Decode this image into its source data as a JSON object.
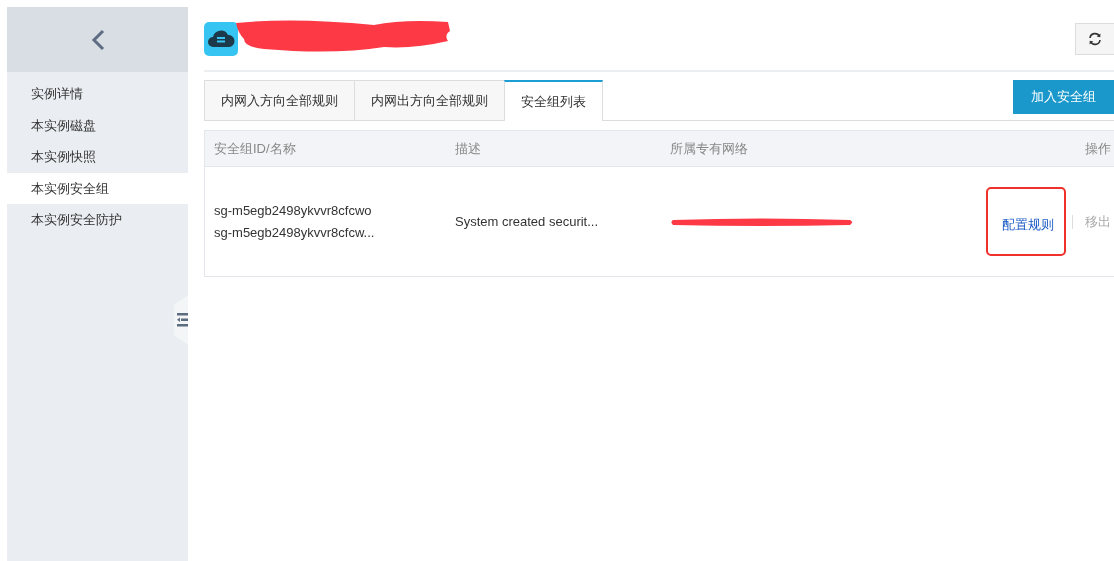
{
  "sidebar": {
    "items": [
      {
        "label": "实例详情",
        "selected": false
      },
      {
        "label": "本实例磁盘",
        "selected": false
      },
      {
        "label": "本实例快照",
        "selected": false
      },
      {
        "label": "本实例安全组",
        "selected": true
      },
      {
        "label": "本实例安全防护",
        "selected": false
      }
    ]
  },
  "tabs": [
    {
      "label": "内网入方向全部规则",
      "selected": false
    },
    {
      "label": "内网出方向全部规则",
      "selected": false
    },
    {
      "label": "安全组列表",
      "selected": true
    }
  ],
  "add_button": "加入安全组",
  "table": {
    "columns": [
      "安全组ID/名称",
      "描述",
      "所属专有网络",
      "操作"
    ],
    "rows": [
      {
        "id": "sg-m5egb2498ykvvr8cfcwo",
        "name": "sg-m5egb2498ykvvr8cfcw...",
        "description": "System created securit...",
        "actions": [
          {
            "label": "配置规则",
            "disabled": false,
            "highlighted": true
          },
          {
            "label": "移出",
            "disabled": true,
            "highlighted": false
          }
        ]
      }
    ]
  }
}
